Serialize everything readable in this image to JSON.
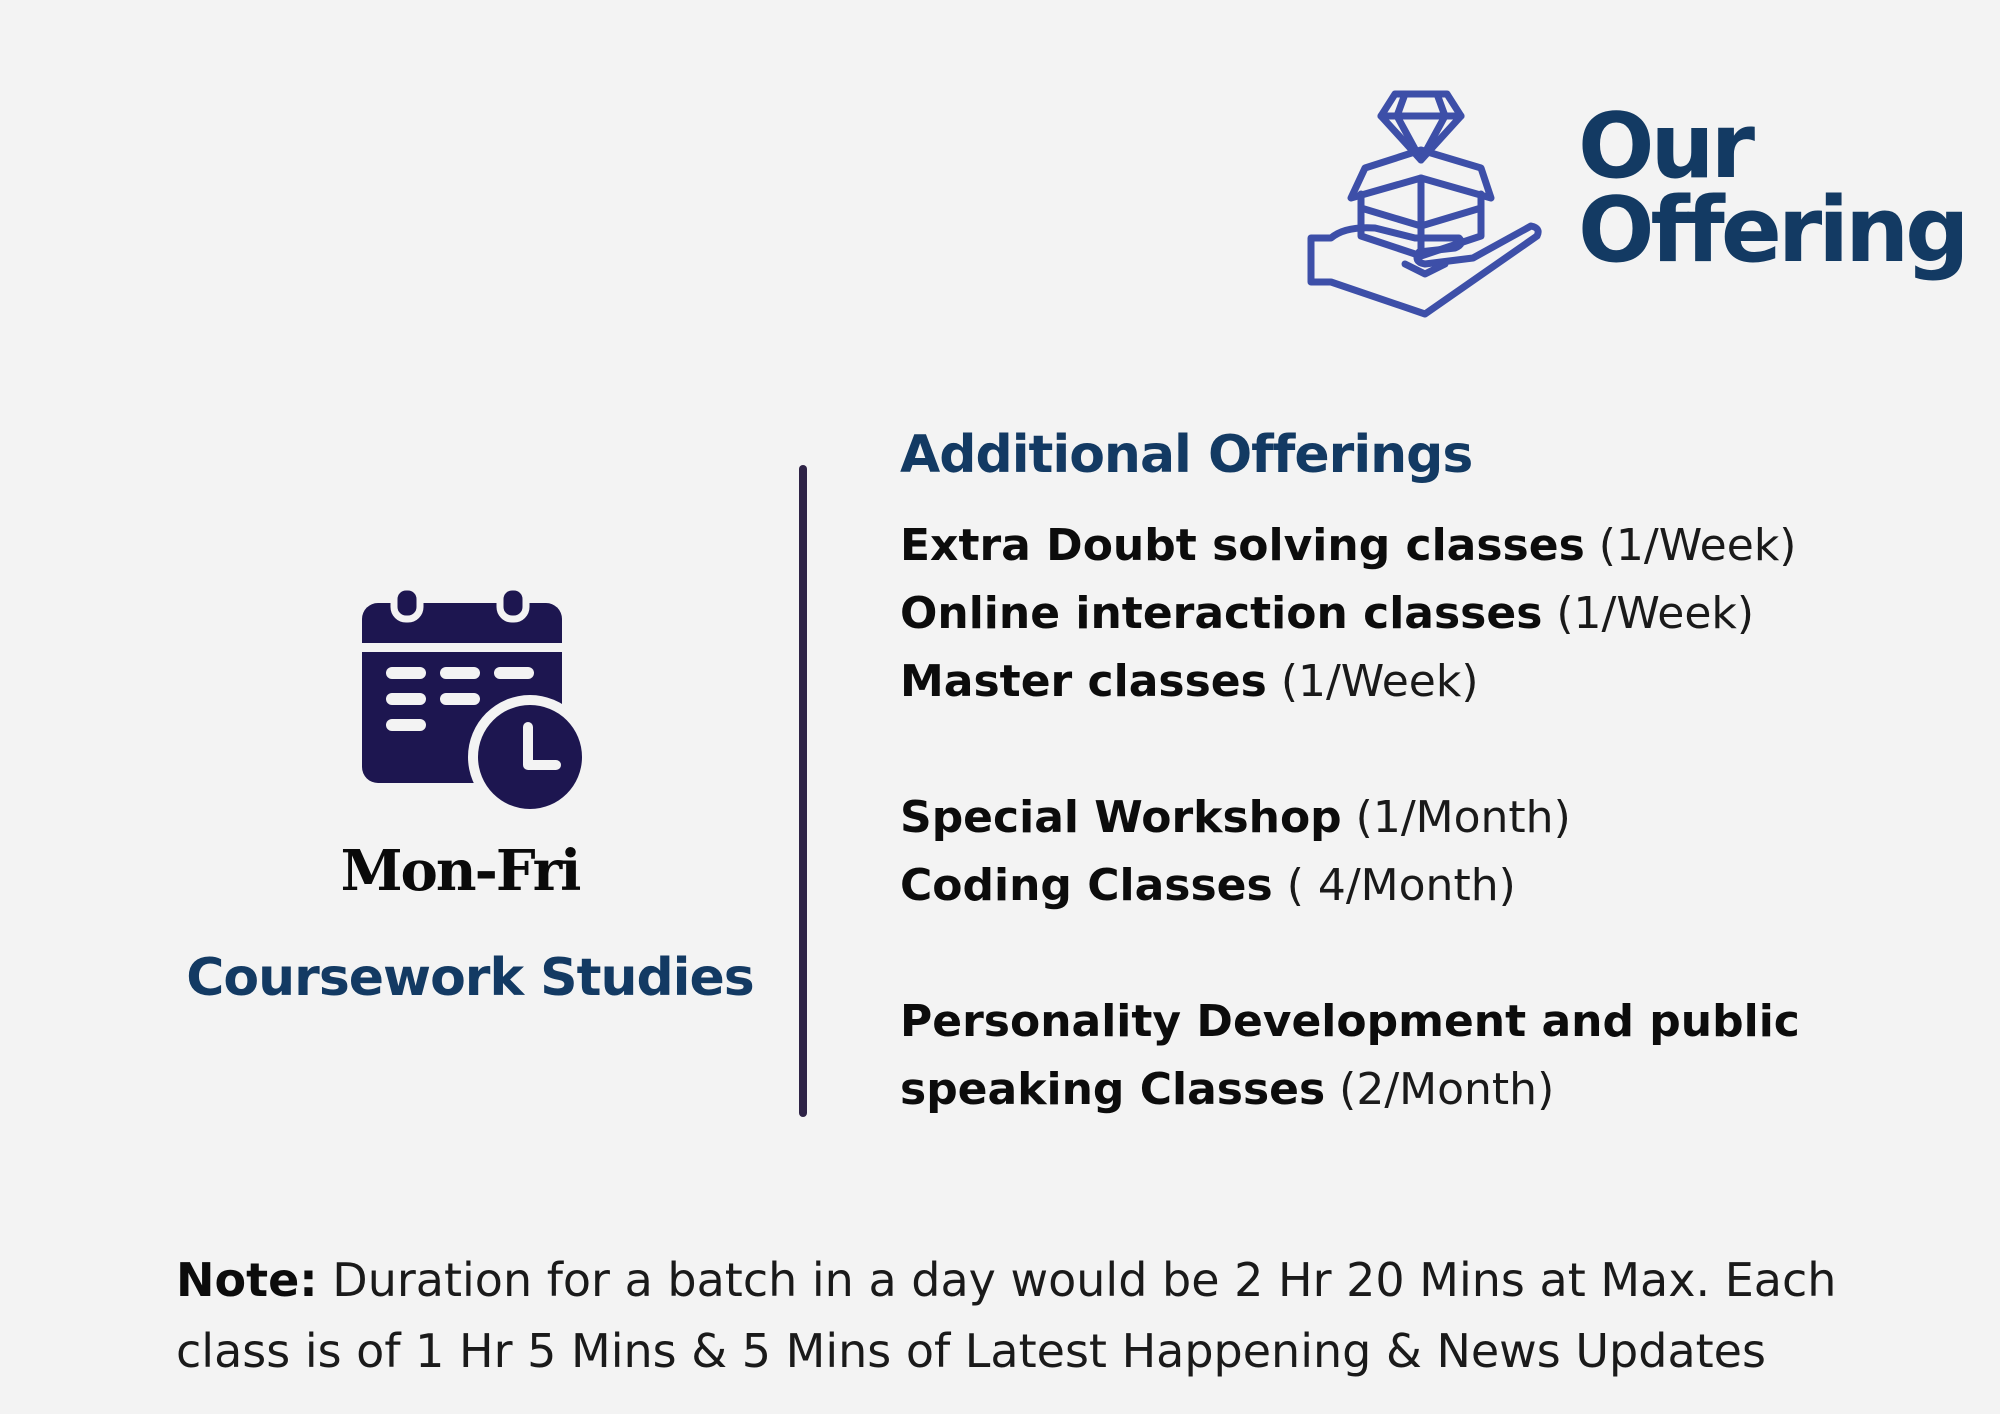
{
  "header": {
    "title_line1": "Our",
    "title_line2": "Offering",
    "icon": "gift-hand-icon"
  },
  "left": {
    "icon": "calendar-clock-icon",
    "days": "Mon-Fri",
    "studies": "Coursework Studies"
  },
  "right": {
    "title": "Additional Offerings",
    "items": [
      {
        "bold": "Extra Doubt solving classes",
        "freq": " (1/Week)"
      },
      {
        "bold": "Online interaction classes",
        "freq": " (1/Week)"
      },
      {
        "bold": "Master classes",
        "freq": " (1/Week)"
      },
      {
        "bold": "Special Workshop",
        "freq": " (1/Month)"
      },
      {
        "bold": "Coding Classes",
        "freq": " ( 4/Month)"
      },
      {
        "bold": "Personality Development and public",
        "freq": ""
      },
      {
        "bold": "speaking Classes",
        "freq": " (2/Month)"
      }
    ]
  },
  "note": {
    "label": "Note:",
    "line1": " Duration for a batch in a day would be 2 Hr 20 Mins at Max. Each",
    "line2": "class is of 1 Hr 5 Mins & 5 Mins of Latest Happening & News Updates"
  },
  "colors": {
    "background": "#f3f3f3",
    "heading_blue": "#133a63",
    "icon_blue": "#3d4fa8",
    "calendar_navy": "#1d1650",
    "divider": "#2e2346"
  }
}
